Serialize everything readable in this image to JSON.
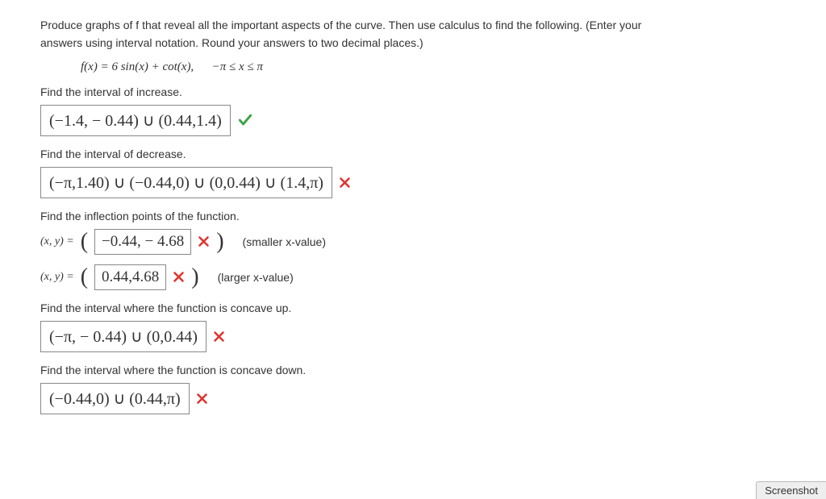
{
  "intro_line1": "Produce graphs of f that reveal all the important aspects of the curve. Then use calculus to find the following. (Enter your",
  "intro_line2": "answers using interval notation. Round your answers to two decimal places.)",
  "function_def": "f(x) = 6 sin(x) + cot(x),   −π ≤ x ≤ π",
  "q_increase": "Find the interval of increase.",
  "a_increase": "(−1.4, − 0.44) ∪ (0.44,1.4)",
  "q_decrease": "Find the interval of decrease.",
  "a_decrease": "(−π,1.40) ∪ (−0.44,0) ∪ (0,0.44) ∪ (1.4,π)",
  "q_inflection": "Find the inflection points of the function.",
  "inflection_prefix": "(x, y)  =",
  "a_inflection1": "−0.44, − 4.68",
  "inflection1_side": "(smaller x-value)",
  "a_inflection2": "0.44,4.68",
  "inflection2_side": "(larger x-value)",
  "q_concave_up": "Find the interval where the function is concave up.",
  "a_concave_up": "(−π, − 0.44) ∪ (0,0.44)",
  "q_concave_down": "Find the interval where the function is concave down.",
  "a_concave_down": "(−0.44,0) ∪ (0.44,π)",
  "screenshot_label": "Screenshot"
}
